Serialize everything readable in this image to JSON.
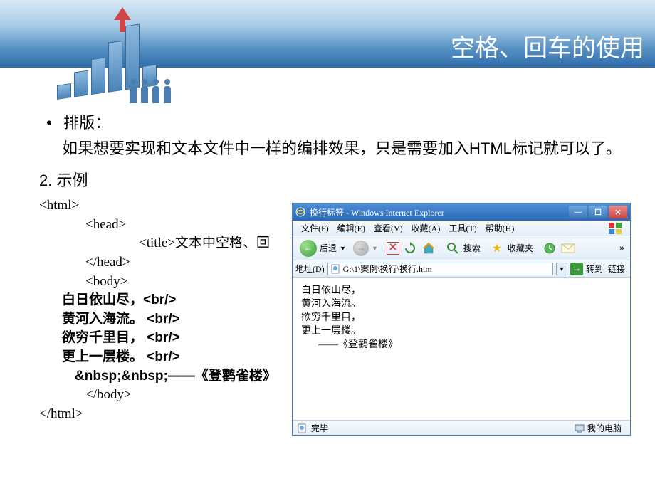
{
  "slide_title": "空格、回车的使用",
  "bullet_label": "排版：",
  "bullet_text": "如果想要实现和文本文件中一样的编排效果，只是需要加入HTML标记就可以了。",
  "list_number": "2.",
  "list_label": "示例",
  "code": {
    "l1": "<html>",
    "l2": "<head>",
    "l3": "<title>文本中空格、回",
    "l4": "</head>",
    "l5": "<body>",
    "p1": "白日依山尽，<br/>",
    "p2": "黄河入海流。 <br/>",
    "p3": "欲穷千里目， <br/>",
    "p4": "更上一层楼。 <br/>",
    "p5": "&nbsp;&nbsp;——《登鹳雀楼》",
    "l6": "</body>",
    "l7": "</html>"
  },
  "ie": {
    "title": "换行标签 - Windows Internet Explorer",
    "menu": {
      "file": "文件(F)",
      "edit": "编辑(E)",
      "view": "查看(V)",
      "fav": "收藏(A)",
      "tools": "工具(T)",
      "help": "帮助(H)"
    },
    "toolbar": {
      "back": "后退",
      "search": "搜索",
      "favorites": "收藏夹"
    },
    "address": {
      "label": "地址(D)",
      "value": "G:\\1\\案例\\换行\\换行.htm",
      "go": "转到",
      "links": "链接"
    },
    "body": {
      "l1": "白日依山尽，",
      "l2": "黄河入海流。",
      "l3": "欲穷千里目，",
      "l4": "更上一层楼。",
      "l5": "——《登鹳雀楼》"
    },
    "status": {
      "done": "完毕",
      "zone": "我的电脑"
    }
  }
}
